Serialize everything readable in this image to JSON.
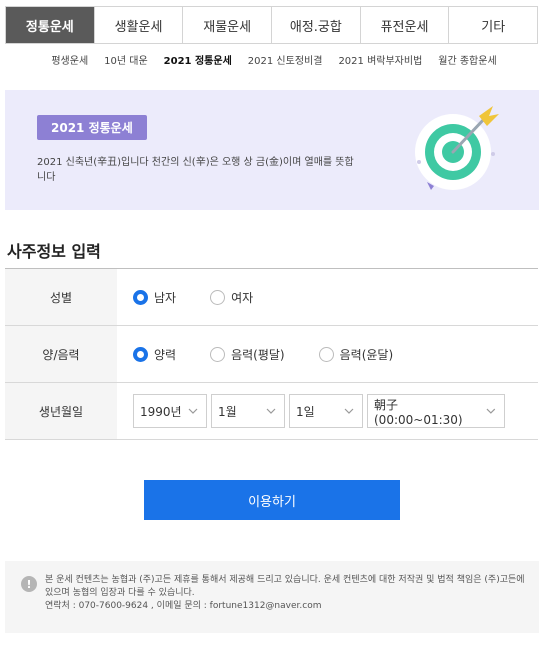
{
  "tabs": [
    {
      "label": "정통운세",
      "active": true
    },
    {
      "label": "생활운세"
    },
    {
      "label": "재물운세"
    },
    {
      "label": "애정.궁합"
    },
    {
      "label": "퓨전운세"
    },
    {
      "label": "기타"
    }
  ],
  "subnav": [
    {
      "label": "평생운세"
    },
    {
      "label": "10년 대운"
    },
    {
      "label": "2021 정통운세",
      "active": true
    },
    {
      "label": "2021 신토정비결"
    },
    {
      "label": "2021 벼락부자비법"
    },
    {
      "label": "월간 종합운세"
    }
  ],
  "banner": {
    "badge": "2021 정통운세",
    "description": "2021 신축년(辛丑)입니다 천간의 신(辛)은 오행 상 금(金)이며 열매를 뜻합니다",
    "icon": "target-icon",
    "colors": {
      "background": "#ecebfb",
      "badge": "#8d80d4",
      "target": "#3fc9a3",
      "arrow": "#f0c53a"
    }
  },
  "section_title": "사주정보 입력",
  "form": {
    "gender": {
      "label": "성별",
      "options": [
        "남자",
        "여자"
      ],
      "selected": "남자"
    },
    "calendar": {
      "label": "양/음력",
      "options": [
        "양력",
        "음력(평달)",
        "음력(윤달)"
      ],
      "selected": "양력"
    },
    "birth": {
      "label": "생년월일",
      "year": "1990년",
      "month": "1월",
      "day": "1일",
      "time": "朝子(00:00~01:30)"
    }
  },
  "submit_label": "이용하기",
  "accent_color": "#1a73e8",
  "notice": {
    "line1": "본 운세 컨텐츠는 농협과 (주)고든 제휴를 통해서 제공해 드리고 있습니다. 운세 컨텐츠에 대한 저작권 및 법적 책임은 (주)고든에 있으며 농협의 입장과 다를 수 있습니다.",
    "contact": "연락처 : 070-7600-9624 , 이메일 문의 : fortune1312@naver.com"
  }
}
